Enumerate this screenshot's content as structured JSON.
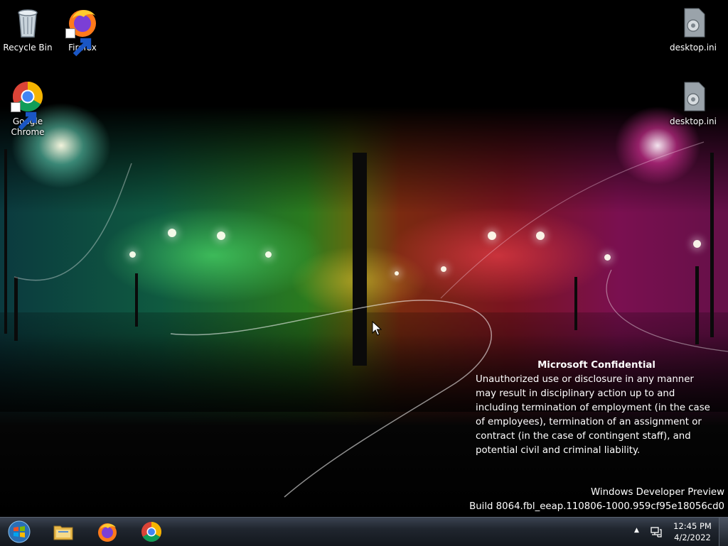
{
  "desktop": {
    "icons": [
      {
        "label": "Recycle Bin",
        "icon": "recycle-bin-icon"
      },
      {
        "label": "Firefox",
        "icon": "firefox-icon"
      },
      {
        "label": "Google Chrome",
        "icon": "chrome-icon"
      },
      {
        "label": "desktop.ini",
        "icon": "settings-file-icon"
      },
      {
        "label": "desktop.ini",
        "icon": "settings-file-icon"
      }
    ],
    "confidential": {
      "title": "Microsoft Confidential",
      "body": "Unauthorized use or disclosure in any manner may result in disciplinary action up to and including termination of employment (in the case of employees), termination of an assignment or contract (in the case of contingent staff), and potential civil and criminal liability."
    },
    "watermark": {
      "line1": "Windows Developer Preview",
      "line2": "Build 8064.fbl_eeap.110806-1000.959cf95e18056cd0"
    }
  },
  "taskbar": {
    "start_icon": "windows-start-icon",
    "pinned": [
      {
        "name": "File Explorer",
        "icon": "file-explorer-icon"
      },
      {
        "name": "Firefox",
        "icon": "firefox-icon"
      },
      {
        "name": "Google Chrome",
        "icon": "chrome-icon"
      }
    ],
    "tray": {
      "overflow_icon": "tray-overflow-arrow-icon",
      "network_icon": "network-icon"
    },
    "clock": {
      "time": "12:45 PM",
      "date": "4/2/2022"
    }
  }
}
